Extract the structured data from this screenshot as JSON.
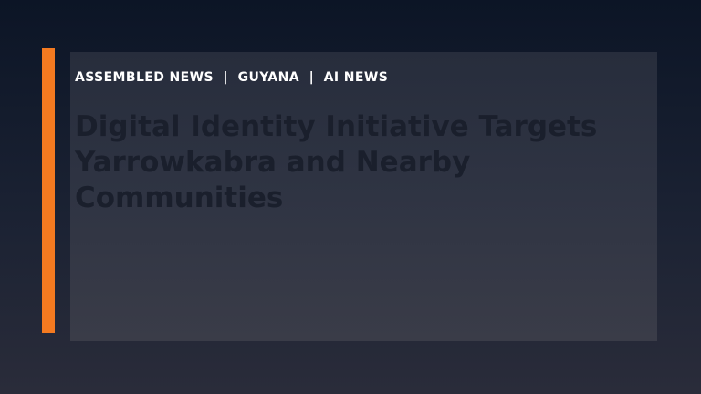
{
  "kicker": {
    "source": "ASSEMBLED NEWS",
    "separator": "|",
    "region": "GUYANA",
    "category": "AI NEWS"
  },
  "headline": "Digital Identity Initiative Targets Yarrowkabra and Nearby Communities",
  "colors": {
    "accent": "#f47a20",
    "kicker_text": "#ffffff",
    "headline_text": "#1a1f2c",
    "background_top": "#0c1526",
    "background_bottom": "#2a2c3a"
  }
}
